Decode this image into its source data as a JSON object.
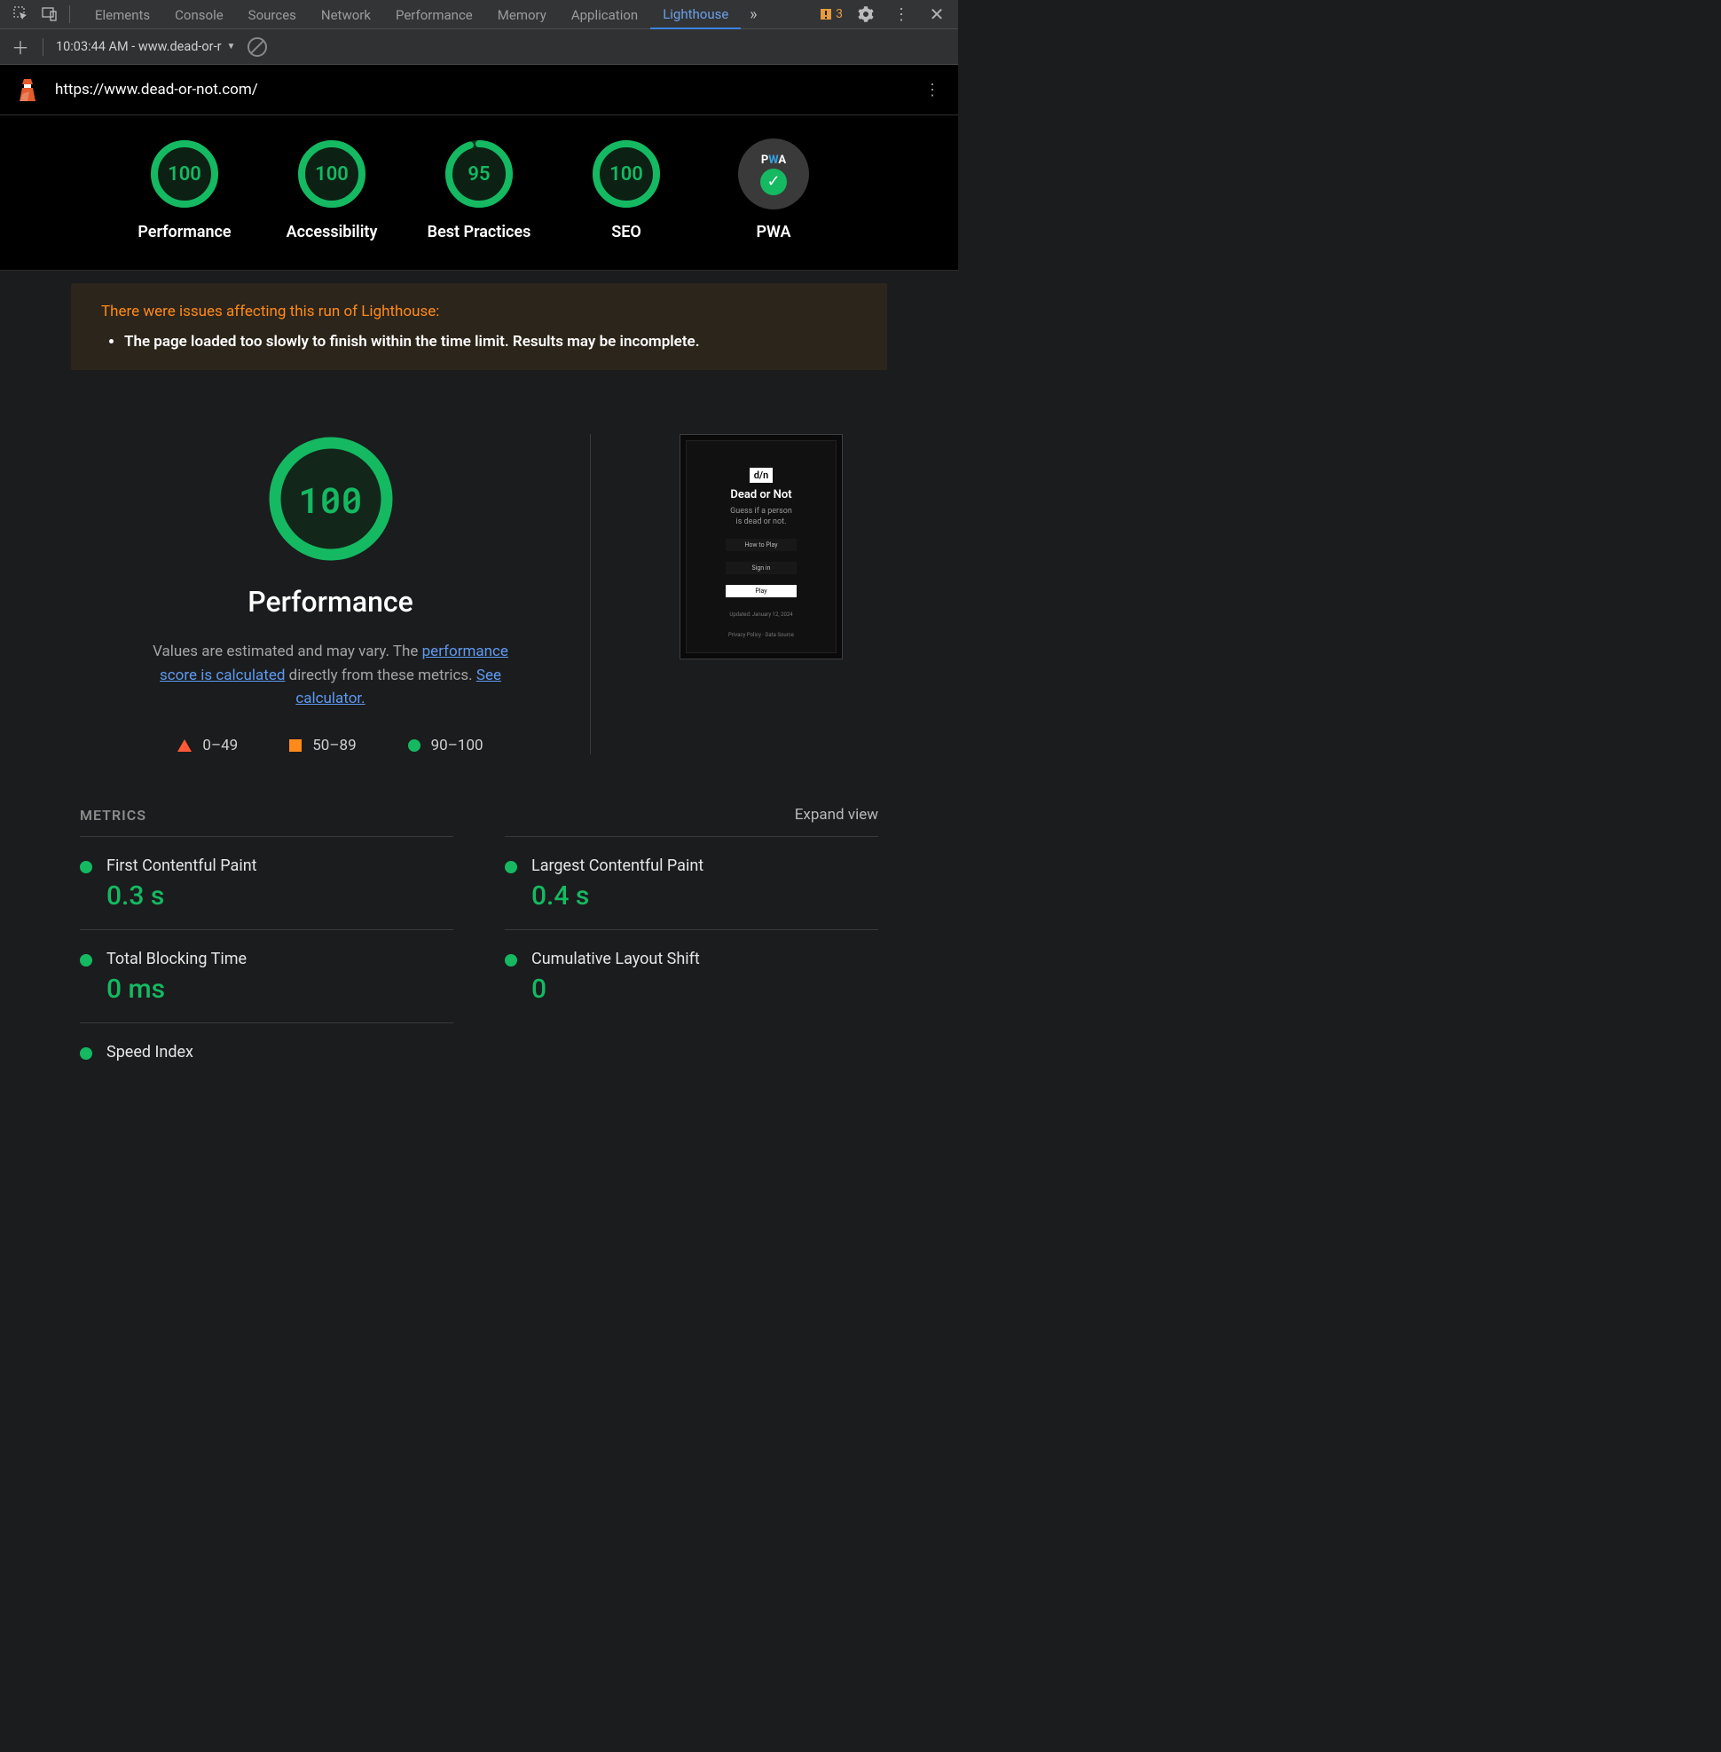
{
  "topbar": {
    "tabs": [
      "Elements",
      "Console",
      "Sources",
      "Network",
      "Performance",
      "Memory",
      "Application",
      "Lighthouse"
    ],
    "active_tab": "Lighthouse",
    "warning_count": "3"
  },
  "secbar": {
    "selected_run": "10:03:44 AM - www.dead-or-r"
  },
  "urlbar": {
    "url": "https://www.dead-or-not.com/"
  },
  "gauges": [
    {
      "label": "Performance",
      "score": "100",
      "color": "green",
      "pct": 100
    },
    {
      "label": "Accessibility",
      "score": "100",
      "color": "green",
      "pct": 100
    },
    {
      "label": "Best Practices",
      "score": "95",
      "color": "green",
      "pct": 95
    },
    {
      "label": "SEO",
      "score": "100",
      "color": "green",
      "pct": 100
    }
  ],
  "pwa": {
    "label": "PWA",
    "status": "pass"
  },
  "warning": {
    "title": "There were issues affecting this run of Lighthouse:",
    "item": "The page loaded too slowly to finish within the time limit. Results may be incomplete."
  },
  "perf_detail": {
    "score": "100",
    "title": "Performance",
    "desc_pre": "Values are estimated and may vary. The ",
    "link1": "performance score is calculated",
    "desc_mid": " directly from these metrics. ",
    "link2": "See calculator.",
    "legend": {
      "r0": "0–49",
      "r1": "50–89",
      "r2": "90–100"
    }
  },
  "thumb": {
    "logo": "d/n",
    "title": "Dead or Not",
    "sub_l1": "Guess if a person",
    "sub_l2": "is dead or not.",
    "btn1": "How to Play",
    "btn2": "Sign in",
    "btn3": "Play",
    "updated": "Updated: January 12, 2024",
    "foot": "Privacy Policy · Data Source"
  },
  "metrics_header": {
    "title": "METRICS",
    "expand": "Expand view"
  },
  "metrics": [
    {
      "name": "First Contentful Paint",
      "value": "0.3 s"
    },
    {
      "name": "Largest Contentful Paint",
      "value": "0.4 s"
    },
    {
      "name": "Total Blocking Time",
      "value": "0 ms"
    },
    {
      "name": "Cumulative Layout Shift",
      "value": "0"
    },
    {
      "name": "Speed Index",
      "value": ""
    }
  ]
}
